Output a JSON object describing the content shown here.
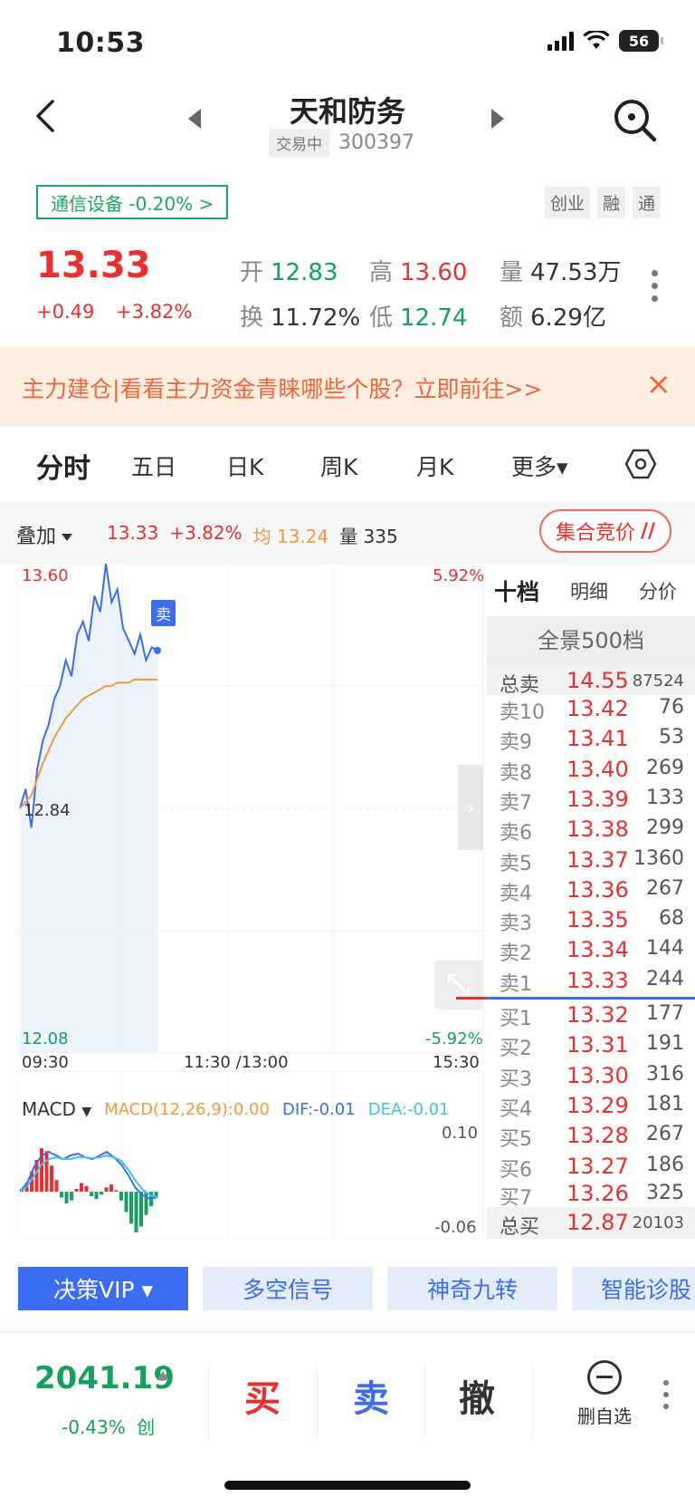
{
  "status_bar": {
    "time": "10:53",
    "battery": "56"
  },
  "header": {
    "title": "天和防务",
    "trading_tag": "交易中",
    "code": "300397"
  },
  "sector": {
    "label": "通信设备 -0.20% >"
  },
  "badges": [
    "创业",
    "融",
    "通"
  ],
  "quote": {
    "price": "13.33",
    "change": "+0.49",
    "change_pct": "+3.82%",
    "open_label": "开",
    "open": "12.83",
    "high_label": "高",
    "high": "13.60",
    "volume_label": "量",
    "volume": "47.53万",
    "turnover_label": "换",
    "turnover": "11.72%",
    "low_label": "低",
    "low": "12.74",
    "amount_label": "额",
    "amount": "6.29亿"
  },
  "promo": {
    "text": "主力建仓|看看主力资金青睐哪些个股？立即前往>>",
    "close": "×"
  },
  "tabs": [
    "分时",
    "五日",
    "日K",
    "周K",
    "月K",
    "更多▾"
  ],
  "overlay": {
    "label": "叠加",
    "price": "13.33",
    "pct": "+3.82%",
    "avg": "均 13.24",
    "vol_label": "量",
    "vol": "335",
    "auction": "集合竞价"
  },
  "chart": {
    "y_top": "13.60",
    "y_mid": "12.84",
    "y_bottom": "12.08",
    "pct_top": "5.92%",
    "pct_bottom": "-5.92%",
    "time_start": "09:30",
    "time_mid": "11:30 /13:00",
    "time_end": "15:30",
    "sell_marker": "卖",
    "macd_label": "MACD",
    "macd_params": "MACD(12,26,9):0.00",
    "dif": "DIF:-0.01",
    "dea": "DEA:-0.01",
    "macd_top": "0.10",
    "macd_bottom": "-0.06"
  },
  "chart_data": {
    "type": "line",
    "x_range": [
      "09:30",
      "15:30"
    ],
    "ylim": [
      12.08,
      13.6
    ],
    "series": [],
    "price_path": [
      12.84,
      12.9,
      12.78,
      12.96,
      13.05,
      13.1,
      13.18,
      13.22,
      13.3,
      13.25,
      13.38,
      13.42,
      13.36,
      13.5,
      13.45,
      13.6,
      13.48,
      13.52,
      13.4,
      13.36,
      13.32,
      13.38,
      13.3,
      13.34,
      13.33
    ],
    "avg_path": [
      12.84,
      12.86,
      12.88,
      12.93,
      12.98,
      13.02,
      13.06,
      13.09,
      13.12,
      13.14,
      13.16,
      13.18,
      13.19,
      13.2,
      13.21,
      13.22,
      13.22,
      13.23,
      13.23,
      13.23,
      13.24,
      13.24,
      13.24,
      13.24,
      13.24
    ]
  },
  "book": {
    "tabs": [
      "十档",
      "明细",
      "分价"
    ],
    "full_depth": "全景500档",
    "total_sell": {
      "name": "总卖",
      "price": "14.55",
      "vol": "87524"
    },
    "asks": [
      {
        "name": "卖10",
        "price": "13.42",
        "vol": "76"
      },
      {
        "name": "卖9",
        "price": "13.41",
        "vol": "53"
      },
      {
        "name": "卖8",
        "price": "13.40",
        "vol": "269"
      },
      {
        "name": "卖7",
        "price": "13.39",
        "vol": "133"
      },
      {
        "name": "卖6",
        "price": "13.38",
        "vol": "299"
      },
      {
        "name": "卖5",
        "price": "13.37",
        "vol": "1360"
      },
      {
        "name": "卖4",
        "price": "13.36",
        "vol": "267"
      },
      {
        "name": "卖3",
        "price": "13.35",
        "vol": "68"
      },
      {
        "name": "卖2",
        "price": "13.34",
        "vol": "144"
      },
      {
        "name": "卖1",
        "price": "13.33",
        "vol": "244"
      }
    ],
    "bids": [
      {
        "name": "买1",
        "price": "13.32",
        "vol": "177"
      },
      {
        "name": "买2",
        "price": "13.31",
        "vol": "191"
      },
      {
        "name": "买3",
        "price": "13.30",
        "vol": "316"
      },
      {
        "name": "买4",
        "price": "13.29",
        "vol": "181"
      },
      {
        "name": "买5",
        "price": "13.28",
        "vol": "267"
      },
      {
        "name": "买6",
        "price": "13.27",
        "vol": "186"
      },
      {
        "name": "买7",
        "price": "13.26",
        "vol": "325"
      }
    ],
    "total_buy": {
      "name": "总买",
      "price": "12.87",
      "vol": "20103"
    }
  },
  "chips": [
    "决策VIP ▾",
    "多空信号",
    "神奇九转",
    "智能诊股"
  ],
  "bottom": {
    "index": "2041.19",
    "index_chg": "-0.43%",
    "index_tag": "创",
    "buy": "买",
    "sell": "卖",
    "cancel": "撤",
    "remove_watch": "删自选"
  },
  "colors": {
    "up": "#e93030",
    "down": "#17a05d",
    "accent": "#3a6df0",
    "avg_line": "#f39a3c"
  }
}
